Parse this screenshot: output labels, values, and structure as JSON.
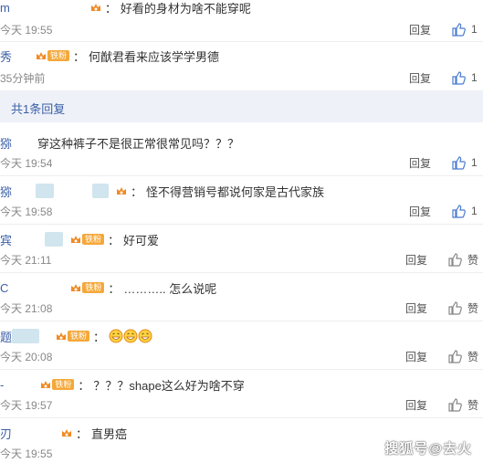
{
  "top_comments": [
    {
      "name": "m",
      "text": "好看的身材为啥不能穿呢",
      "time": "今天 19:55",
      "reply": "回复",
      "likes": "1"
    },
    {
      "name": "秀",
      "fan_badge": "铁粉",
      "text": "何猷君看来应该学学男德",
      "time": "35分钟前",
      "reply": "回复",
      "likes": "1"
    }
  ],
  "reply_bar": {
    "label": "共1条回复"
  },
  "comments": [
    {
      "name": "猕",
      "text": "穿这种裤子不是很正常很常见吗？？？",
      "time": "今天 19:54",
      "reply": "回复",
      "likes": "1"
    },
    {
      "name": "猕",
      "text": "怪不得营销号都说何家是古代家族",
      "time": "今天 19:58",
      "reply": "回复",
      "likes": "1"
    },
    {
      "name": "宾",
      "fan_badge": "铁粉",
      "text": "好可爱",
      "time": "今天 21:11",
      "reply": "回复",
      "likes": "赞"
    },
    {
      "name": "C",
      "fan_badge": "铁粉",
      "text": "……….. 怎么说呢",
      "time": "今天 21:08",
      "reply": "回复",
      "likes": "赞"
    },
    {
      "name": "题",
      "fan_badge": "铁粉",
      "text": "",
      "time": "今天 20:08",
      "reply": "回复",
      "likes": "赞"
    },
    {
      "name": "-",
      "fan_badge": "铁粉",
      "text": "？？？shape这么好为啥不穿",
      "time": "今天 19:57",
      "reply": "回复",
      "likes": "赞"
    },
    {
      "name": "刃",
      "text": "直男癌",
      "time": "今天 19:55",
      "reply": "",
      "likes": ""
    }
  ],
  "watermark": "搜狐号@去火",
  "colors": {
    "accent": "#3c5fa7",
    "badge": "#f4a83a",
    "reply_bar_bg": "#eef1f7",
    "time": "#888888",
    "like_blue": "#4a7bd0"
  },
  "icons": {
    "like": "thumbs-up-icon",
    "crown": "fan-crown-icon",
    "emoji": "grin-emoji-icon"
  }
}
